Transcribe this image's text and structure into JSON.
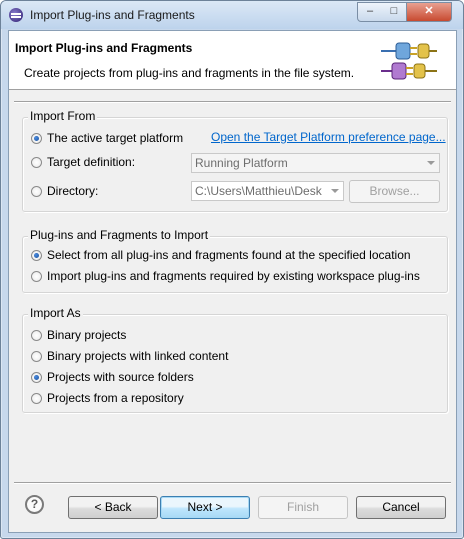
{
  "window": {
    "title": "Import Plug-ins and Fragments"
  },
  "window_controls": {
    "minimize": "–",
    "maximize": "□",
    "close": "✕"
  },
  "banner": {
    "title": "Import Plug-ins and Fragments",
    "description": "Create projects from plug-ins and fragments in the file system."
  },
  "import_from": {
    "label": "Import From",
    "active_target": "The active target platform",
    "link": "Open the Target Platform preference page...",
    "target_definition": "Target definition:",
    "target_definition_value": "Running Platform",
    "directory": "Directory:",
    "directory_value": "C:\\Users\\Matthieu\\Desk",
    "browse": "Browse...",
    "selected": "active_target"
  },
  "plugins_group": {
    "label": "Plug-ins and Fragments to Import",
    "options": [
      {
        "label": "Select from all plug-ins and fragments found at the specified location",
        "selected": true
      },
      {
        "label": "Import plug-ins and fragments required by existing workspace plug-ins",
        "selected": false
      }
    ]
  },
  "import_as": {
    "label": "Import As",
    "options": [
      {
        "label": "Binary projects",
        "selected": false
      },
      {
        "label": "Binary projects with linked content",
        "selected": false
      },
      {
        "label": "Projects with source folders",
        "selected": true
      },
      {
        "label": "Projects from a repository",
        "selected": false
      }
    ]
  },
  "buttons": {
    "help": "?",
    "back": "< Back",
    "next": "Next >",
    "finish": "Finish",
    "cancel": "Cancel"
  },
  "icons": [
    "eclipse-app-icon",
    "plug-connector-icon",
    "help-icon"
  ]
}
